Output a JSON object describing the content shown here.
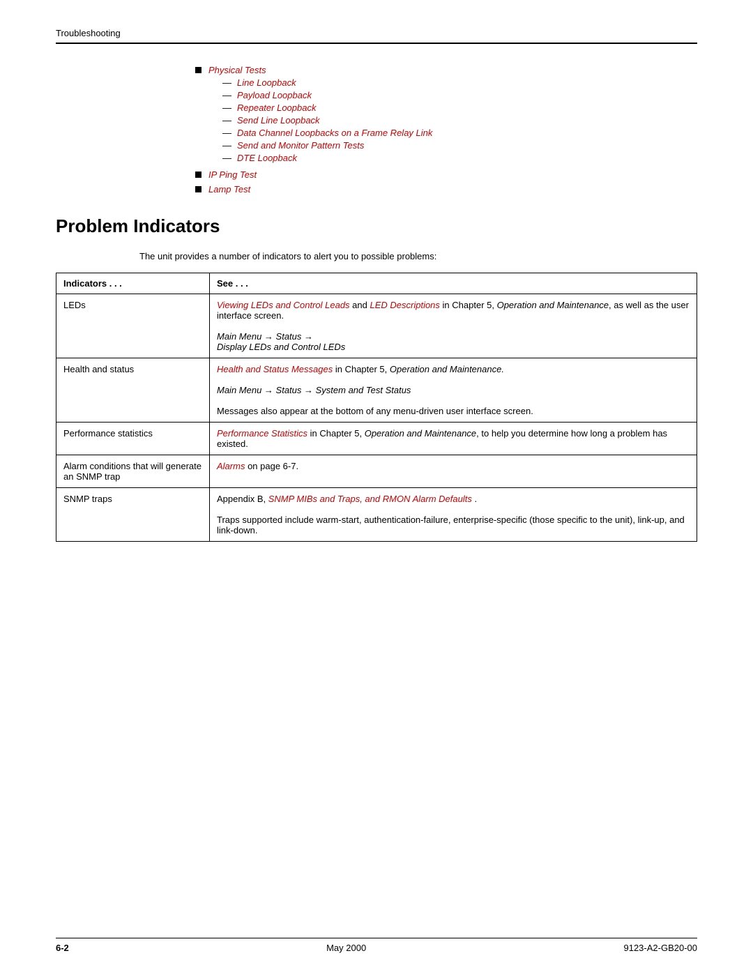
{
  "header": {
    "title": "Troubleshooting"
  },
  "bullet_list": {
    "items": [
      {
        "label": "Physical Tests",
        "sub_items": [
          "Line Loopback",
          "Payload Loopback",
          "Repeater Loopback",
          "Send Line Loopback",
          "Data Channel Loopbacks on a Frame Relay Link",
          "Send and Monitor Pattern Tests",
          "DTE Loopback"
        ]
      },
      {
        "label": "IP Ping Test",
        "sub_items": []
      },
      {
        "label": "Lamp Test",
        "sub_items": []
      }
    ]
  },
  "section": {
    "heading": "Problem Indicators",
    "intro": "The unit provides a number of indicators to alert you to possible problems:"
  },
  "table": {
    "headers": [
      "Indicators . . .",
      "See . . ."
    ],
    "rows": [
      {
        "indicator": "LEDs",
        "see_parts": [
          {
            "type": "text_with_links",
            "content": "viewing_leds_row"
          }
        ]
      },
      {
        "indicator": "Health and status",
        "see_parts": [
          {
            "type": "text_with_links",
            "content": "health_status_row"
          }
        ]
      },
      {
        "indicator": "Performance statistics",
        "see_parts": [
          {
            "type": "text_with_links",
            "content": "perf_stats_row"
          }
        ]
      },
      {
        "indicator": "Alarm conditions that will generate an SNMP trap",
        "see_parts": [
          {
            "type": "text_with_links",
            "content": "alarm_row"
          }
        ]
      },
      {
        "indicator": "SNMP traps",
        "see_parts": [
          {
            "type": "text_with_links",
            "content": "snmp_row"
          }
        ]
      }
    ],
    "leds_link": "Viewing LEDs and Control Leads",
    "led_desc_link": "LED Descriptions",
    "leds_main_text": " in Chapter 5, ",
    "leds_italic": "Operation and Maintenance",
    "leds_end": ", as well as the user interface screen.",
    "leds_menu": "Main Menu → Status →",
    "leds_display": "Display LEDs and Control LEDs",
    "health_link": "Health and Status Messages",
    "health_mid": " in Chapter 5, ",
    "health_italic": "Operation and Maintenance.",
    "health_menu": "Main Menu → Status → System and Test Status",
    "health_end": "Messages also appear at the bottom of any menu-driven user interface screen.",
    "perf_link": "Performance Statistics",
    "perf_mid": " in Chapter 5, ",
    "perf_italic_op": "Operation and",
    "perf_italic_maint": "Maintenance",
    "perf_end": ", to help you determine how long a problem has existed.",
    "alarm_link": "Alarms",
    "alarm_end": " on page 6-7.",
    "snmp_start": "Appendix B, ",
    "snmp_link": "SNMP MIBs and Traps, and RMON Alarm Defaults",
    "snmp_trap_text": "Traps supported include warm-start, authentication-failure, enterprise-specific (those specific to the unit), link-up, and link-down."
  },
  "footer": {
    "left": "6-2",
    "center": "May 2000",
    "right": "9123-A2-GB20-00"
  }
}
